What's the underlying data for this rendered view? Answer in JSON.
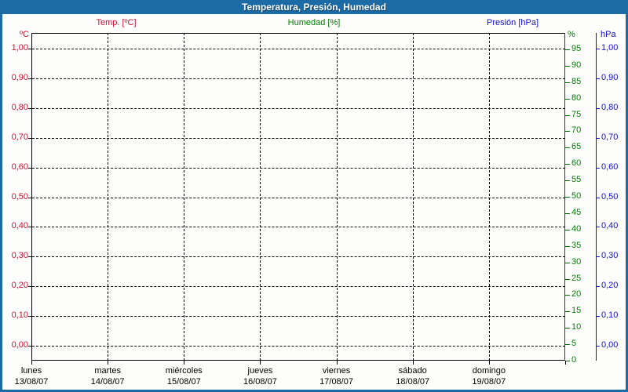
{
  "window": {
    "title": "Temperatura, Presión, Humedad"
  },
  "legend": {
    "items": [
      {
        "label": "Temp. [ºC]",
        "color": "#cc1133"
      },
      {
        "label": "Humedad [%]",
        "color": "#008000"
      },
      {
        "label": "Presión [hPa]",
        "color": "#1111cc"
      }
    ]
  },
  "chart_data": {
    "type": "line",
    "title": "Temperatura, Presión, Humedad",
    "grid": "dashed",
    "series": [
      {
        "name": "Temp. [ºC]",
        "color": "#cc1133",
        "values": []
      },
      {
        "name": "Humedad [%]",
        "color": "#008000",
        "values": []
      },
      {
        "name": "Presión [hPa]",
        "color": "#1111cc",
        "values": []
      }
    ],
    "x_axis": {
      "days": [
        {
          "weekday": "lunes",
          "date": "13/08/07"
        },
        {
          "weekday": "martes",
          "date": "14/08/07"
        },
        {
          "weekday": "miércoles",
          "date": "15/08/07"
        },
        {
          "weekday": "jueves",
          "date": "16/08/07"
        },
        {
          "weekday": "viernes",
          "date": "17/08/07"
        },
        {
          "weekday": "sábado",
          "date": "18/08/07"
        },
        {
          "weekday": "domingo",
          "date": "19/08/07"
        }
      ]
    },
    "y_axes": {
      "temperature": {
        "unit": "ºC",
        "color": "#cc1133",
        "side": "left",
        "ticks": [
          "1,00",
          "0,90",
          "0,80",
          "0,70",
          "0,60",
          "0,50",
          "0,40",
          "0,30",
          "0,20",
          "0,10",
          "0,00"
        ]
      },
      "humidity": {
        "unit": "%",
        "color": "#008000",
        "side": "right",
        "range": [
          0,
          100
        ],
        "ticks": [
          95,
          90,
          85,
          80,
          75,
          70,
          65,
          60,
          55,
          50,
          45,
          40,
          35,
          30,
          25,
          20,
          15,
          10,
          5,
          0
        ]
      },
      "pressure": {
        "unit": "hPa",
        "color": "#1111cc",
        "side": "right",
        "ticks": [
          "1,00",
          "0,90",
          "0,80",
          "0,70",
          "0,60",
          "0,50",
          "0,40",
          "0,30",
          "0,20",
          "0,10",
          "0,00"
        ]
      }
    }
  }
}
